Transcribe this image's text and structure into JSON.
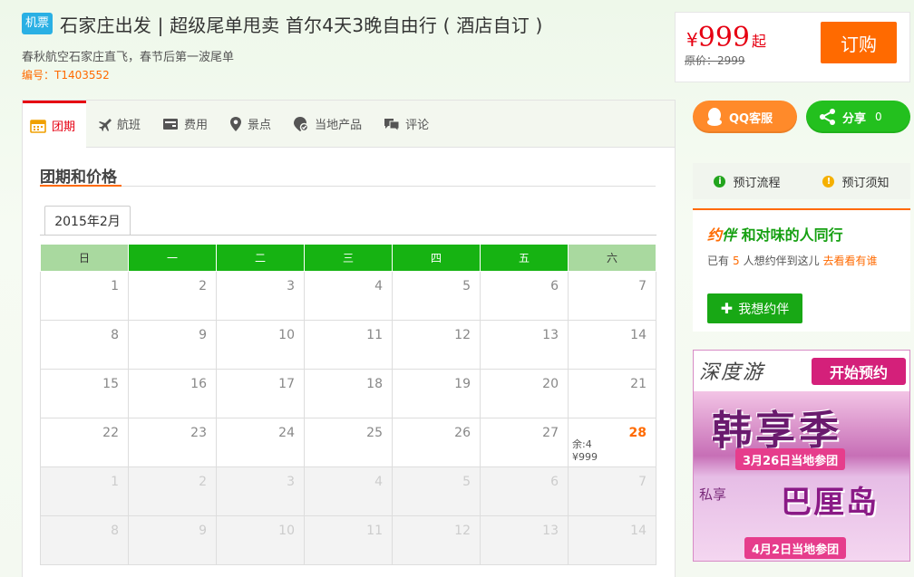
{
  "header": {
    "tag": "机票",
    "title": "石家庄出发 | 超级尾单甩卖 首尔4天3晚自由行 ( 酒店自订 )",
    "subtitle": "春秋航空石家庄直飞，春节后第一波尾单",
    "code_label": "编号：",
    "code_value": "T1403552"
  },
  "price": {
    "currency": "¥",
    "amount": "999",
    "suffix": "起",
    "original": "原价：2999",
    "book_label": "订购"
  },
  "tabs": [
    {
      "label": "团期",
      "icon": "calendar-icon",
      "active": true
    },
    {
      "label": "航班",
      "icon": "plane-icon",
      "active": false
    },
    {
      "label": "费用",
      "icon": "wallet-icon",
      "active": false
    },
    {
      "label": "景点",
      "icon": "map-pin-icon",
      "active": false
    },
    {
      "label": "当地产品",
      "icon": "local-product-icon",
      "active": false
    },
    {
      "label": "评论",
      "icon": "comment-icon",
      "active": false
    }
  ],
  "section": {
    "title": "团期和价格",
    "month_tab": "2015年2月"
  },
  "calendar": {
    "weekdays": [
      "日",
      "一",
      "二",
      "三",
      "四",
      "五",
      "六"
    ],
    "weeks": [
      [
        {
          "d": "1"
        },
        {
          "d": "2"
        },
        {
          "d": "3"
        },
        {
          "d": "4"
        },
        {
          "d": "5"
        },
        {
          "d": "6"
        },
        {
          "d": "7"
        }
      ],
      [
        {
          "d": "8"
        },
        {
          "d": "9"
        },
        {
          "d": "10"
        },
        {
          "d": "11"
        },
        {
          "d": "12"
        },
        {
          "d": "13"
        },
        {
          "d": "14"
        }
      ],
      [
        {
          "d": "15"
        },
        {
          "d": "16"
        },
        {
          "d": "17"
        },
        {
          "d": "18"
        },
        {
          "d": "19"
        },
        {
          "d": "20"
        },
        {
          "d": "21"
        }
      ],
      [
        {
          "d": "22"
        },
        {
          "d": "23"
        },
        {
          "d": "24"
        },
        {
          "d": "25"
        },
        {
          "d": "26"
        },
        {
          "d": "27"
        },
        {
          "d": "28",
          "avail": true,
          "remain": "余:4",
          "price": "¥999"
        }
      ],
      [
        {
          "d": "1",
          "next": true
        },
        {
          "d": "2",
          "next": true
        },
        {
          "d": "3",
          "next": true
        },
        {
          "d": "4",
          "next": true
        },
        {
          "d": "5",
          "next": true
        },
        {
          "d": "6",
          "next": true
        },
        {
          "d": "7",
          "next": true
        }
      ],
      [
        {
          "d": "8",
          "next": true
        },
        {
          "d": "9",
          "next": true
        },
        {
          "d": "10",
          "next": true
        },
        {
          "d": "11",
          "next": true
        },
        {
          "d": "12",
          "next": true
        },
        {
          "d": "13",
          "next": true
        },
        {
          "d": "14",
          "next": true
        }
      ]
    ]
  },
  "sidebar": {
    "qq_label": "QQ客服",
    "share_label": "分享",
    "share_count": "0",
    "process_label": "预订流程",
    "notice_label": "预订须知",
    "companion": {
      "title_yue": "约",
      "title_ban": "伴",
      "title_rest": "和对味的人同行",
      "text_pre": "已有",
      "count": "5",
      "text_mid": "人想约伴到这儿",
      "link": "去看看有谁",
      "button": "我想约伴"
    },
    "ad": {
      "brand": "深度游",
      "start": "开始预约",
      "big1": "韩享季",
      "date1": "3月26日当地参团",
      "sub": "私享",
      "big2": "巴厘岛",
      "date2": "4月2日当地参团"
    }
  },
  "colors": {
    "accent_orange": "#ff6a00",
    "accent_red": "#e60012",
    "green": "#16b312",
    "light_green": "#a9d99f"
  }
}
